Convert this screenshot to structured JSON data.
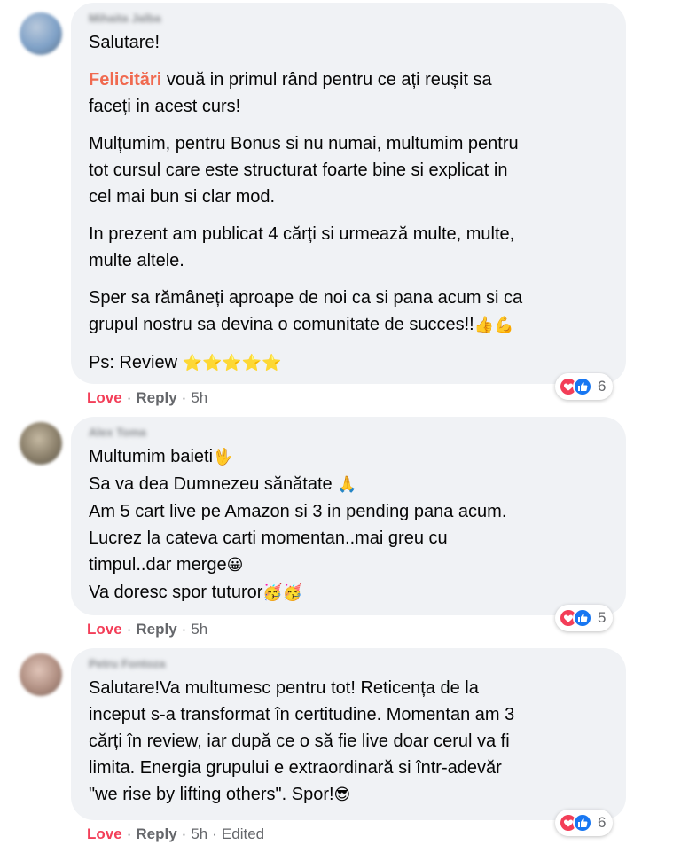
{
  "comments": [
    {
      "author": "Mihaita Jalba",
      "avatar_color": "#7fa1c7",
      "paragraphs": [
        {
          "text": "Salutare!"
        },
        {
          "highlight": "Felicitări",
          "text": " vouă in primul rând pentru ce ați reușit sa\nfaceți in acest curs!"
        },
        {
          "text": "Mulțumim, pentru Bonus si nu numai, multumim pentru\ntot cursul care este structurat foarte bine si explicat in\ncel mai bun si clar mod."
        },
        {
          "text": "In prezent am publicat 4 cărți si urmează multe, multe,\nmulte altele."
        },
        {
          "text": "Sper sa rămâneți aproape de noi ca si pana acum si ca\ngrupul nostru sa devina o comunitate de succes!!",
          "emoji": "👍💪"
        },
        {
          "text": "Ps: Review ",
          "emoji": "⭐⭐⭐⭐⭐"
        }
      ],
      "actions": {
        "love": "Love",
        "reply": "Reply",
        "time": "5h",
        "edited": ""
      },
      "reactions": {
        "count": "6"
      }
    },
    {
      "author": "Alex Toma",
      "avatar_color": "#8a7f6a",
      "paragraphs": [
        {
          "text": "Multumim baieti",
          "emoji": "🖖"
        },
        {
          "text": "Sa va dea Dumnezeu sănătate ",
          "emoji": "🙏"
        },
        {
          "text": "Am 5 cart live pe Amazon si 3 in pending pana acum."
        },
        {
          "text": "Lucrez la cateva carti momentan..mai greu cu\ntimpul..dar merge",
          "emoji": "😀"
        },
        {
          "text": "Va doresc spor tuturor",
          "emoji": "🥳🥳"
        }
      ],
      "actions": {
        "love": "Love",
        "reply": "Reply",
        "time": "5h",
        "edited": ""
      },
      "reactions": {
        "count": "5"
      }
    },
    {
      "author": "Petru Fontoza",
      "avatar_color": "#b08f82",
      "paragraphs": [
        {
          "text": "Salutare!Va multumesc pentru tot! Reticența de la\ninceput s-a transformat în certitudine. Momentan am 3\ncărți în review, iar după ce o să fie live doar cerul va fi\nlimita. Energia grupului e extraordinară si într-adevăr\n\"we rise by lifting others\". Spor!",
          "emoji": "😎"
        }
      ],
      "actions": {
        "love": "Love",
        "reply": "Reply",
        "time": "5h",
        "edited": "Edited"
      },
      "reactions": {
        "count": "6"
      }
    }
  ]
}
